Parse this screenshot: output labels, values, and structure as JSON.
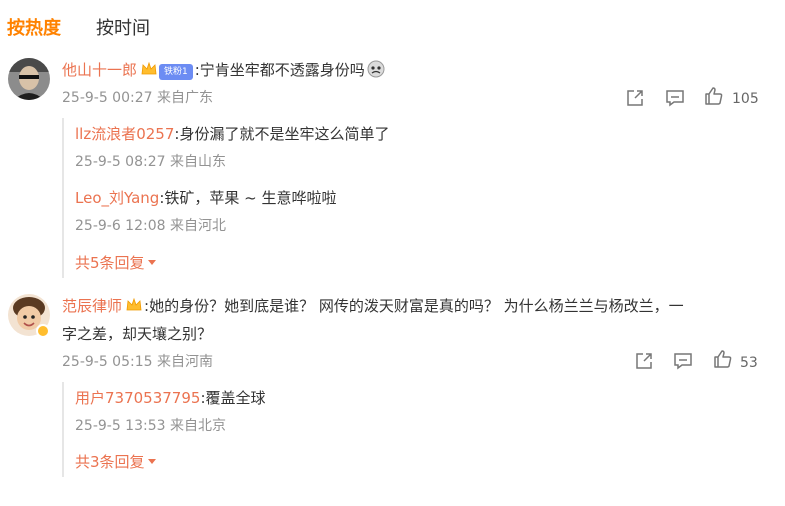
{
  "tabs": {
    "hot": "按热度",
    "time": "按时间"
  },
  "comments": [
    {
      "user": "他山十一郎",
      "fan_badge": "铁粉1",
      "text": ":宁肯坐牢都不透露身份吗",
      "meta": "25-9-5 00:27 来自广东",
      "likes": "105",
      "replies": [
        {
          "user": "llz流浪者0257",
          "text": ":身份漏了就不是坐牢这么简单了",
          "meta": "25-9-5 08:27 来自山东"
        },
        {
          "user": "Leo_刘Yang",
          "text": ":铁矿，苹果 ~ 生意哗啦啦",
          "meta": "25-9-6 12:08 来自河北"
        }
      ],
      "more": "共5条回复"
    },
    {
      "user": "范辰律师",
      "text_line1": ":她的身份？她到底是谁？ 网传的泼天财富是真的吗？ 为什么杨兰兰与杨改兰，一",
      "text_line2": "字之差，却天壤之别？",
      "meta": "25-9-5 05:15 来自河南",
      "likes": "53",
      "replies": [
        {
          "user": "用户7370537795",
          "text": ":覆盖全球",
          "meta": "25-9-5 13:53 来自北京"
        }
      ],
      "more": "共3条回复"
    }
  ],
  "colors": {
    "accent": "#ff8200",
    "username": "#eb7350",
    "meta": "#939393",
    "thread_line": "#e6e6e6"
  },
  "icons": [
    "share-icon",
    "comment-icon",
    "like-icon",
    "crown-icon",
    "verified-badge-icon",
    "emoji-icon",
    "caret-down-icon"
  ]
}
